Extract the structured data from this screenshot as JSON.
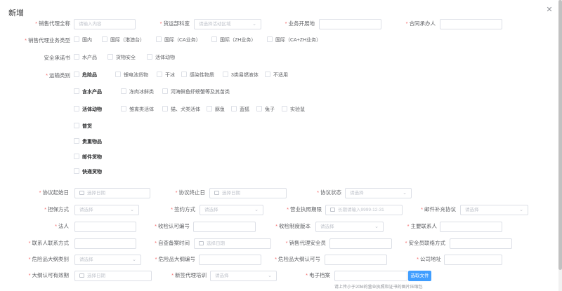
{
  "dialog": {
    "title": "新增"
  },
  "row1": {
    "full_name": {
      "label": "销售代理全称",
      "placeholder": "请输入内容"
    },
    "freight_dept": {
      "label": "货运部科室",
      "placeholder": "请选择活动区域"
    },
    "business_area": {
      "label": "业务开展地"
    },
    "contract_undertaker": {
      "label": "合同承办人"
    }
  },
  "business_type": {
    "label": "销售代理业务类型",
    "options": [
      "国内",
      "国际（港澳台）",
      "国际（CA业务）",
      "国际（ZH业务）",
      "国际（CA+ZH业务）"
    ]
  },
  "safety_commitment": {
    "label": "安全承诺书",
    "options": [
      "水产品",
      "货物安全",
      "活体动物"
    ]
  },
  "transport": {
    "label": "运输类别",
    "dangerous": {
      "label": "危险品",
      "subs": [
        "锂电池货物",
        "干冰",
        "感染性物质",
        "3类易燃液体",
        "不适用"
      ]
    },
    "aquatic": {
      "label": "含水产品",
      "subs": [
        "冻肉冰鲜类",
        "河海鲜鱼虾螃蟹等及其苗类"
      ]
    },
    "live": {
      "label": "活体动物",
      "subs": [
        "雏禽类活体",
        "猫、犬类活体",
        "豚鱼",
        "蓝狐",
        "兔子",
        "实验鼠"
      ]
    },
    "general": "普货",
    "valuable": "贵重物品",
    "mail": "邮件货物",
    "express": "快递货物"
  },
  "row_agreement": {
    "start": {
      "label": "协议起始日",
      "placeholder": "选择日期"
    },
    "end": {
      "label": "协议终止日",
      "placeholder": "选择日期"
    },
    "status": {
      "label": "协议状态",
      "placeholder": "请选择"
    }
  },
  "row_guarantee": {
    "guarantee": {
      "label": "担保方式",
      "placeholder": "请选择"
    },
    "sign": {
      "label": "签约方式",
      "placeholder": "请选择"
    },
    "license_period": {
      "label": "营业执照期限",
      "placeholder": "长期请输入9999-12-31"
    },
    "mail_supplement": {
      "label": "邮件补充协议",
      "placeholder": "请选择"
    }
  },
  "row_legal": {
    "legal_person": {
      "label": "法人"
    },
    "cert_no": {
      "label": "收检认可编号"
    },
    "system_version": {
      "label": "收检制度版本",
      "placeholder": "请选择"
    },
    "main_contact": {
      "label": "主要联系人"
    }
  },
  "row_contact": {
    "contact_method": {
      "label": "联系人联系方式"
    },
    "self_check_time": {
      "label": "自查备案时间",
      "placeholder": "选择日期"
    },
    "safety_officer": {
      "label": "销售代理安全员"
    },
    "safety_contact": {
      "label": "安全员联络方式"
    }
  },
  "row_dg": {
    "dg_category": {
      "label": "危险品大纲类别",
      "placeholder": "请选择"
    },
    "dg_no": {
      "label": "危险品大纲编号"
    },
    "dg_cert": {
      "label": "危险品大纲认可号"
    },
    "address": {
      "label": "公司地址"
    }
  },
  "row_last": {
    "outline_valid": {
      "label": "大纲认可有效期",
      "placeholder": "选择日期"
    },
    "new_agent_training": {
      "label": "新签代理培训",
      "placeholder": "请选择"
    },
    "e_archive": {
      "label": "电子档案",
      "button": "选取文件",
      "hint": "请上传小于20M的营业执照和证书的图片压缩包"
    }
  }
}
